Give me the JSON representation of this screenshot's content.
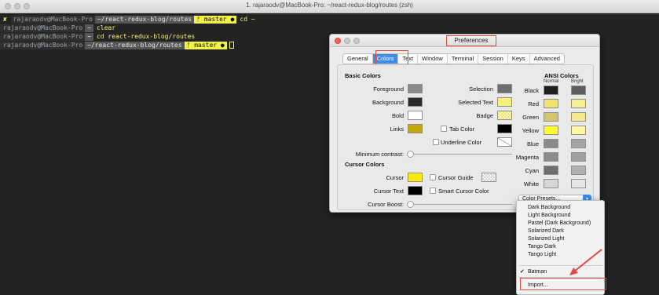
{
  "terminal": {
    "title": "1. rajaraodv@MacBook-Pro: ~/react-redux-blog/routes (zsh)",
    "lines": [
      {
        "mark": "✘",
        "user": "rajaraodv@MacBook-Pro",
        "dir": "~/react-redux-blog/routes",
        "git": "ᚠ master ●",
        "cmd": "cd ~"
      },
      {
        "user": "rajaraodv@MacBook-Pro",
        "dir": "~",
        "cmd": "clear"
      },
      {
        "user": "rajaraodv@MacBook-Pro",
        "dir": "~",
        "cmd": "cd react-redux-blog/routes"
      },
      {
        "user": "rajaraodv@MacBook-Pro",
        "dir": "~/react-redux-blog/routes",
        "git": "ᚠ master ●"
      }
    ]
  },
  "preferences": {
    "title": "Preferences",
    "tabs": [
      "General",
      "Colors",
      "Text",
      "Window",
      "Terminal",
      "Session",
      "Keys",
      "Advanced"
    ],
    "active_tab": "Colors",
    "basic_colors": {
      "heading": "Basic Colors",
      "items": [
        {
          "label": "Foreground",
          "color": "#8a8a8a"
        },
        {
          "label": "Background",
          "color": "#2a2a2a"
        },
        {
          "label": "Bold",
          "color": "#ffffff"
        },
        {
          "label": "Links",
          "color": "#c2a70c"
        }
      ],
      "right_items": [
        {
          "label": "Selection",
          "color": "#6e6e6e"
        },
        {
          "label": "Selected Text",
          "color": "#f5f17a"
        },
        {
          "label": "Badge",
          "color": "checker"
        },
        {
          "label": "Tab Color",
          "color": "#000000"
        },
        {
          "label": "Underline Color",
          "color": "none"
        }
      ],
      "minimum_contrast": "Minimum contrast:"
    },
    "cursor_colors": {
      "heading": "Cursor Colors",
      "cursor": {
        "label": "Cursor",
        "color": "#ffee00"
      },
      "cursor_text": {
        "label": "Cursor Text",
        "color": "#000000"
      },
      "cursor_guide": "Cursor Guide",
      "smart_cursor": "Smart Cursor Color",
      "cursor_boost": "Cursor Boost:"
    },
    "ansi": {
      "heading": "ANSI Colors",
      "normal_label": "Normal",
      "bright_label": "Bright",
      "rows": [
        {
          "name": "Black",
          "normal": "#1e1e1e",
          "bright": "#5e5e5e"
        },
        {
          "name": "Red",
          "normal": "#f0e36d",
          "bright": "#f7ef95"
        },
        {
          "name": "Green",
          "normal": "#d2c56a",
          "bright": "#f2ea91"
        },
        {
          "name": "Yellow",
          "normal": "#fffb2a",
          "bright": "#fff6a4"
        },
        {
          "name": "Blue",
          "normal": "#8a8a8a",
          "bright": "#a5a5a5"
        },
        {
          "name": "Magenta",
          "normal": "#8c8c8c",
          "bright": "#a1a1a1"
        },
        {
          "name": "Cyan",
          "normal": "#6f6f6f",
          "bright": "#b2b2b2"
        },
        {
          "name": "White",
          "normal": "#d6d6d6",
          "bright": "#e8e8e8"
        }
      ]
    },
    "color_presets_label": "Color Presets..."
  },
  "preset_menu": {
    "items": [
      "Dark Background",
      "Light Background",
      "Pastel (Dark Background)",
      "Solarized Dark",
      "Solarized Light",
      "Tango Dark",
      "Tango Light"
    ],
    "checked_item": "Batman",
    "checkmark": "✓",
    "import_label": "Import..."
  }
}
